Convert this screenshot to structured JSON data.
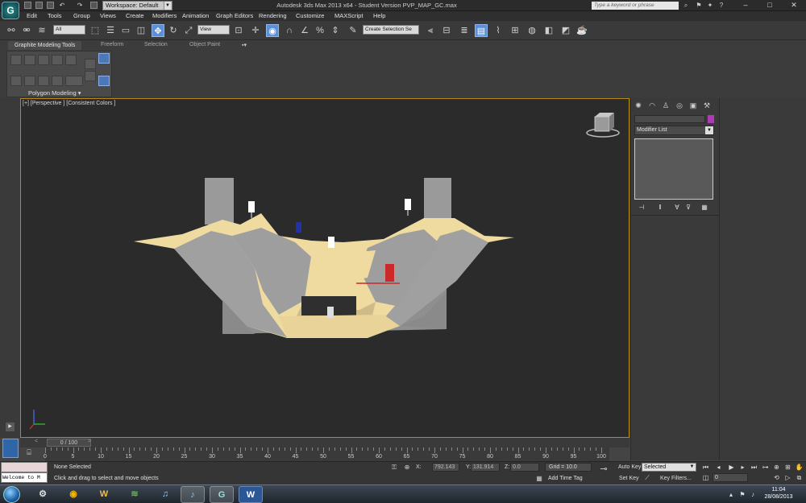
{
  "title_bar": {
    "workspace": "Workspace: Default",
    "window_title": "Autodesk 3ds Max  2013 x64    - Student Version    PVP_MAP_GC.max",
    "search_placeholder": "Type a keyword or phrase"
  },
  "menu": [
    "Edit",
    "Tools",
    "Group",
    "Views",
    "Create",
    "Modifiers",
    "Animation",
    "Graph Editors",
    "Rendering",
    "Customize",
    "MAXScript",
    "Help"
  ],
  "toolbar": {
    "selection_filter": "All",
    "ref_coord": "View",
    "named_selection": "Create Selection Se"
  },
  "ribbon": {
    "tabs": [
      "Graphite Modeling Tools",
      "Freeform",
      "Selection",
      "Object Paint"
    ],
    "panel_label": "Polygon Modeling"
  },
  "viewport": {
    "label": "[+] [Perspective ] [Consistent Colors ]",
    "accent_color": "#b28a1c",
    "scene_colors": {
      "floor": "#efdba0",
      "walls": "#9a9a9a",
      "marker_white": "#ffffff",
      "marker_blue": "#2233aa",
      "marker_red": "#cc2a2a"
    }
  },
  "command_panel": {
    "modifier_list": "Modifier List",
    "object_color": "#b03ab5"
  },
  "time_slider": {
    "position": "0 / 100",
    "ticks": [
      0,
      5,
      10,
      15,
      20,
      25,
      30,
      35,
      40,
      45,
      50,
      55,
      60,
      65,
      70,
      75,
      80,
      85,
      90,
      95,
      100
    ]
  },
  "status": {
    "listener_text": "Welcome to M",
    "selection": "None Selected",
    "prompt": "Click and drag to select and move objects",
    "x_label": "X:",
    "x_value": "792.143",
    "y_label": "Y:",
    "y_value": "131.914",
    "z_label": "Z:",
    "z_value": "0.0",
    "grid": "Grid = 10.0",
    "add_time_tag": "Add Time Tag",
    "auto_key": "Auto Key",
    "set_key": "Set Key",
    "key_mode": "Selected",
    "key_filters": "Key Filters...",
    "frame": "0"
  },
  "taskbar": {
    "time": "11:04",
    "date": "28/08/2013",
    "apps": [
      "steam",
      "chrome",
      "world-of-warcraft",
      "spotify",
      "itunes",
      "itunes-alt",
      "3ds-max",
      "word"
    ]
  }
}
